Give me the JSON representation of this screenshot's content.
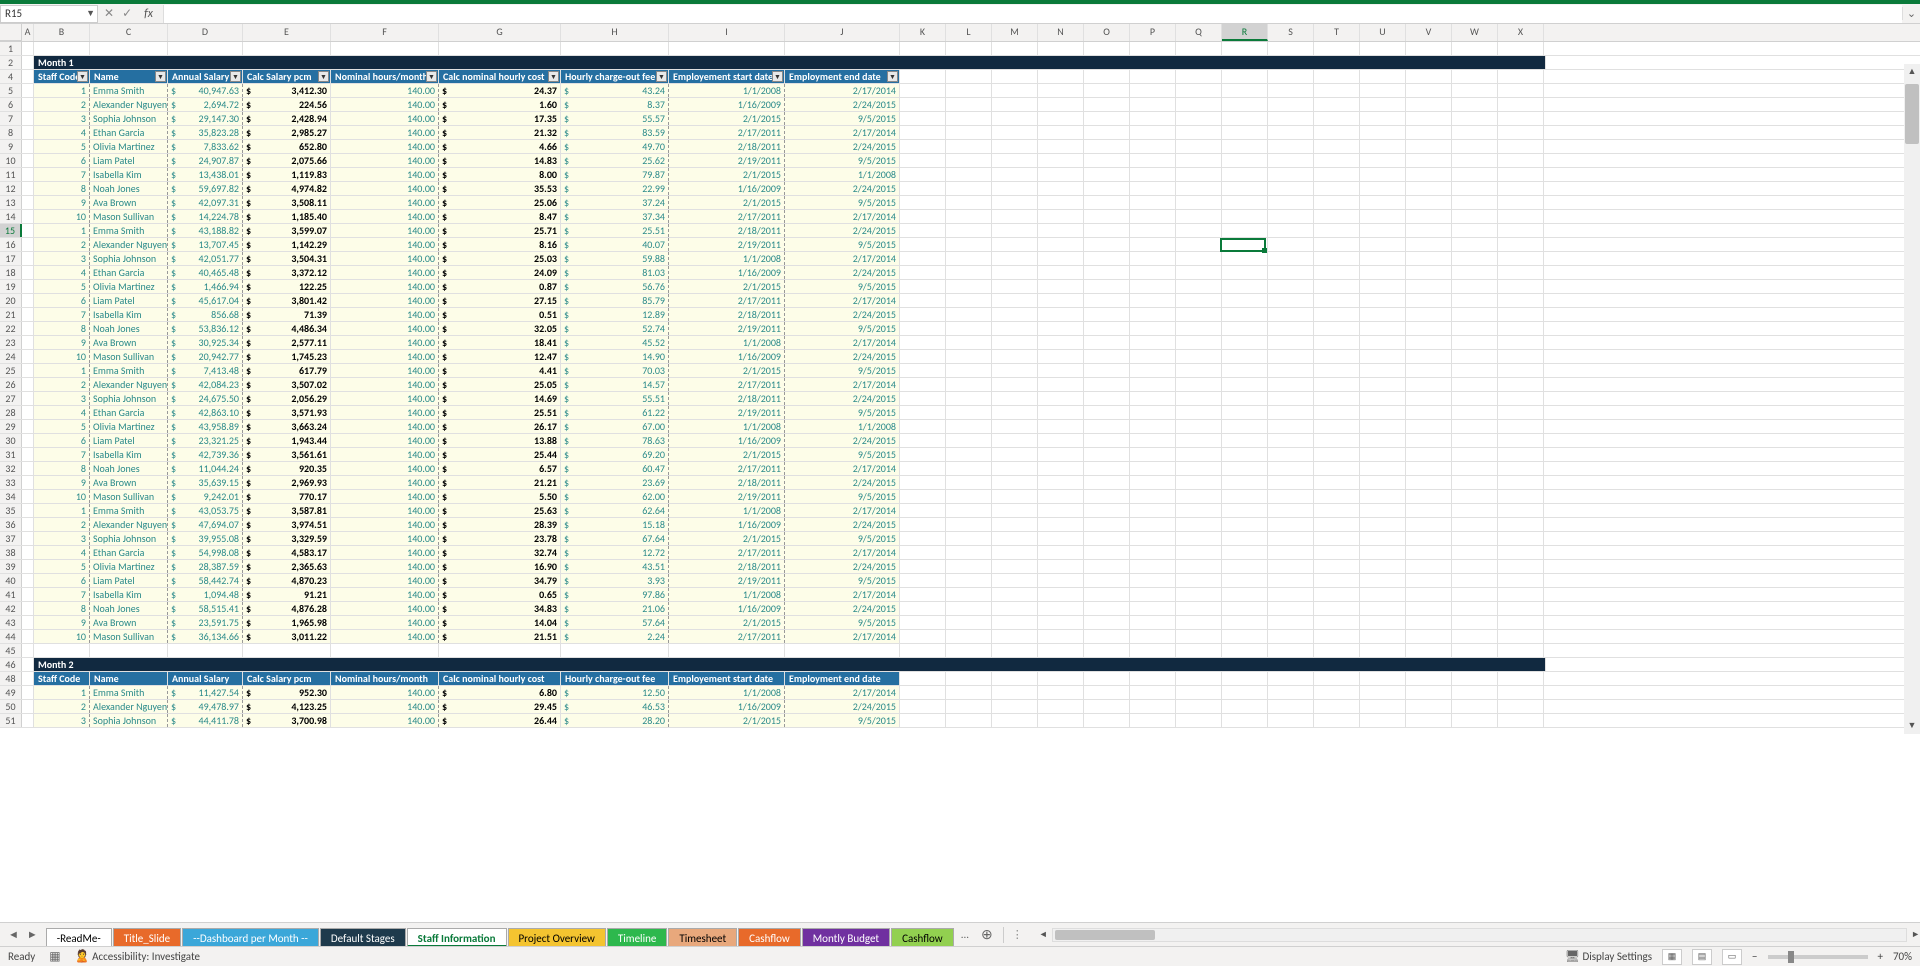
{
  "nameBox": "R15",
  "formulaValue": "",
  "fbIcons": {
    "cancel": "✕",
    "confirm": "✓",
    "fx": "fx"
  },
  "columns": [
    "A",
    "B",
    "C",
    "D",
    "E",
    "F",
    "G",
    "H",
    "I",
    "J",
    "K",
    "L",
    "M",
    "N",
    "O",
    "P",
    "Q",
    "R",
    "S",
    "T",
    "U",
    "V",
    "W",
    "X"
  ],
  "rowStart": 1,
  "month1": {
    "title": "Month 1"
  },
  "month2": {
    "title": "Month 2"
  },
  "tblHeaders": [
    "Staff Code",
    "Name",
    "Annual Salary",
    "Calc Salary pcm",
    "Nominal hours/month",
    "Calc nominal hourly cost",
    "Hourly charge-out fee",
    "Employement start date",
    "Employment end date"
  ],
  "data": [
    {
      "code": 1,
      "name": "Emma Smith",
      "salary": "40,947.63",
      "pcm": "3,412.30",
      "hours": "140.00",
      "hourly": "24.37",
      "fee": "43.24",
      "start": "1/1/2008",
      "end": "2/17/2014"
    },
    {
      "code": 2,
      "name": "Alexander Nguyen",
      "salary": "2,694.72",
      "pcm": "224.56",
      "hours": "140.00",
      "hourly": "1.60",
      "fee": "8.37",
      "start": "1/16/2009",
      "end": "2/24/2015"
    },
    {
      "code": 3,
      "name": "Sophia Johnson",
      "salary": "29,147.30",
      "pcm": "2,428.94",
      "hours": "140.00",
      "hourly": "17.35",
      "fee": "55.57",
      "start": "2/1/2015",
      "end": "9/5/2015"
    },
    {
      "code": 4,
      "name": "Ethan Garcia",
      "salary": "35,823.28",
      "pcm": "2,985.27",
      "hours": "140.00",
      "hourly": "21.32",
      "fee": "83.59",
      "start": "2/17/2011",
      "end": "2/17/2014"
    },
    {
      "code": 5,
      "name": "Olivia Martinez",
      "salary": "7,833.62",
      "pcm": "652.80",
      "hours": "140.00",
      "hourly": "4.66",
      "fee": "49.70",
      "start": "2/18/2011",
      "end": "2/24/2015"
    },
    {
      "code": 6,
      "name": "Liam Patel",
      "salary": "24,907.87",
      "pcm": "2,075.66",
      "hours": "140.00",
      "hourly": "14.83",
      "fee": "25.62",
      "start": "2/19/2011",
      "end": "9/5/2015"
    },
    {
      "code": 7,
      "name": "Isabella Kim",
      "salary": "13,438.01",
      "pcm": "1,119.83",
      "hours": "140.00",
      "hourly": "8.00",
      "fee": "79.87",
      "start": "2/1/2015",
      "end": "1/1/2008"
    },
    {
      "code": 8,
      "name": "Noah Jones",
      "salary": "59,697.82",
      "pcm": "4,974.82",
      "hours": "140.00",
      "hourly": "35.53",
      "fee": "22.99",
      "start": "1/16/2009",
      "end": "2/24/2015"
    },
    {
      "code": 9,
      "name": "Ava Brown",
      "salary": "42,097.31",
      "pcm": "3,508.11",
      "hours": "140.00",
      "hourly": "25.06",
      "fee": "37.24",
      "start": "2/1/2015",
      "end": "9/5/2015"
    },
    {
      "code": 10,
      "name": "Mason Sullivan",
      "salary": "14,224.78",
      "pcm": "1,185.40",
      "hours": "140.00",
      "hourly": "8.47",
      "fee": "37.34",
      "start": "2/17/2011",
      "end": "2/17/2014"
    },
    {
      "code": 1,
      "name": "Emma Smith",
      "salary": "43,188.82",
      "pcm": "3,599.07",
      "hours": "140.00",
      "hourly": "25.71",
      "fee": "25.51",
      "start": "2/18/2011",
      "end": "2/24/2015"
    },
    {
      "code": 2,
      "name": "Alexander Nguyen",
      "salary": "13,707.45",
      "pcm": "1,142.29",
      "hours": "140.00",
      "hourly": "8.16",
      "fee": "40.07",
      "start": "2/19/2011",
      "end": "9/5/2015"
    },
    {
      "code": 3,
      "name": "Sophia Johnson",
      "salary": "42,051.77",
      "pcm": "3,504.31",
      "hours": "140.00",
      "hourly": "25.03",
      "fee": "59.88",
      "start": "1/1/2008",
      "end": "2/17/2014"
    },
    {
      "code": 4,
      "name": "Ethan Garcia",
      "salary": "40,465.48",
      "pcm": "3,372.12",
      "hours": "140.00",
      "hourly": "24.09",
      "fee": "81.03",
      "start": "1/16/2009",
      "end": "2/24/2015"
    },
    {
      "code": 5,
      "name": "Olivia Martinez",
      "salary": "1,466.94",
      "pcm": "122.25",
      "hours": "140.00",
      "hourly": "0.87",
      "fee": "56.76",
      "start": "2/1/2015",
      "end": "9/5/2015"
    },
    {
      "code": 6,
      "name": "Liam Patel",
      "salary": "45,617.04",
      "pcm": "3,801.42",
      "hours": "140.00",
      "hourly": "27.15",
      "fee": "85.79",
      "start": "2/17/2011",
      "end": "2/17/2014"
    },
    {
      "code": 7,
      "name": "Isabella Kim",
      "salary": "856.68",
      "pcm": "71.39",
      "hours": "140.00",
      "hourly": "0.51",
      "fee": "12.89",
      "start": "2/18/2011",
      "end": "2/24/2015"
    },
    {
      "code": 8,
      "name": "Noah Jones",
      "salary": "53,836.12",
      "pcm": "4,486.34",
      "hours": "140.00",
      "hourly": "32.05",
      "fee": "52.74",
      "start": "2/19/2011",
      "end": "9/5/2015"
    },
    {
      "code": 9,
      "name": "Ava Brown",
      "salary": "30,925.34",
      "pcm": "2,577.11",
      "hours": "140.00",
      "hourly": "18.41",
      "fee": "45.52",
      "start": "1/1/2008",
      "end": "2/17/2014"
    },
    {
      "code": 10,
      "name": "Mason Sullivan",
      "salary": "20,942.77",
      "pcm": "1,745.23",
      "hours": "140.00",
      "hourly": "12.47",
      "fee": "14.90",
      "start": "1/16/2009",
      "end": "2/24/2015"
    },
    {
      "code": 1,
      "name": "Emma Smith",
      "salary": "7,413.48",
      "pcm": "617.79",
      "hours": "140.00",
      "hourly": "4.41",
      "fee": "70.03",
      "start": "2/1/2015",
      "end": "9/5/2015"
    },
    {
      "code": 2,
      "name": "Alexander Nguyen",
      "salary": "42,084.23",
      "pcm": "3,507.02",
      "hours": "140.00",
      "hourly": "25.05",
      "fee": "14.57",
      "start": "2/17/2011",
      "end": "2/17/2014"
    },
    {
      "code": 3,
      "name": "Sophia Johnson",
      "salary": "24,675.50",
      "pcm": "2,056.29",
      "hours": "140.00",
      "hourly": "14.69",
      "fee": "55.51",
      "start": "2/18/2011",
      "end": "2/24/2015"
    },
    {
      "code": 4,
      "name": "Ethan Garcia",
      "salary": "42,863.10",
      "pcm": "3,571.93",
      "hours": "140.00",
      "hourly": "25.51",
      "fee": "61.22",
      "start": "2/19/2011",
      "end": "9/5/2015"
    },
    {
      "code": 5,
      "name": "Olivia Martinez",
      "salary": "43,958.89",
      "pcm": "3,663.24",
      "hours": "140.00",
      "hourly": "26.17",
      "fee": "67.00",
      "start": "1/1/2008",
      "end": "1/1/2008"
    },
    {
      "code": 6,
      "name": "Liam Patel",
      "salary": "23,321.25",
      "pcm": "1,943.44",
      "hours": "140.00",
      "hourly": "13.88",
      "fee": "78.63",
      "start": "1/16/2009",
      "end": "2/24/2015"
    },
    {
      "code": 7,
      "name": "Isabella Kim",
      "salary": "42,739.36",
      "pcm": "3,561.61",
      "hours": "140.00",
      "hourly": "25.44",
      "fee": "69.20",
      "start": "2/1/2015",
      "end": "9/5/2015"
    },
    {
      "code": 8,
      "name": "Noah Jones",
      "salary": "11,044.24",
      "pcm": "920.35",
      "hours": "140.00",
      "hourly": "6.57",
      "fee": "60.47",
      "start": "2/17/2011",
      "end": "2/17/2014"
    },
    {
      "code": 9,
      "name": "Ava Brown",
      "salary": "35,639.15",
      "pcm": "2,969.93",
      "hours": "140.00",
      "hourly": "21.21",
      "fee": "23.69",
      "start": "2/18/2011",
      "end": "2/24/2015"
    },
    {
      "code": 10,
      "name": "Mason Sullivan",
      "salary": "9,242.01",
      "pcm": "770.17",
      "hours": "140.00",
      "hourly": "5.50",
      "fee": "62.00",
      "start": "2/19/2011",
      "end": "9/5/2015"
    },
    {
      "code": 1,
      "name": "Emma Smith",
      "salary": "43,053.75",
      "pcm": "3,587.81",
      "hours": "140.00",
      "hourly": "25.63",
      "fee": "62.64",
      "start": "1/1/2008",
      "end": "2/17/2014"
    },
    {
      "code": 2,
      "name": "Alexander Nguyen",
      "salary": "47,694.07",
      "pcm": "3,974.51",
      "hours": "140.00",
      "hourly": "28.39",
      "fee": "15.18",
      "start": "1/16/2009",
      "end": "2/24/2015"
    },
    {
      "code": 3,
      "name": "Sophia Johnson",
      "salary": "39,955.08",
      "pcm": "3,329.59",
      "hours": "140.00",
      "hourly": "23.78",
      "fee": "67.64",
      "start": "2/1/2015",
      "end": "9/5/2015"
    },
    {
      "code": 4,
      "name": "Ethan Garcia",
      "salary": "54,998.08",
      "pcm": "4,583.17",
      "hours": "140.00",
      "hourly": "32.74",
      "fee": "12.72",
      "start": "2/17/2011",
      "end": "2/17/2014"
    },
    {
      "code": 5,
      "name": "Olivia Martinez",
      "salary": "28,387.59",
      "pcm": "2,365.63",
      "hours": "140.00",
      "hourly": "16.90",
      "fee": "43.51",
      "start": "2/18/2011",
      "end": "2/24/2015"
    },
    {
      "code": 6,
      "name": "Liam Patel",
      "salary": "58,442.74",
      "pcm": "4,870.23",
      "hours": "140.00",
      "hourly": "34.79",
      "fee": "3.93",
      "start": "2/19/2011",
      "end": "9/5/2015"
    },
    {
      "code": 7,
      "name": "Isabella Kim",
      "salary": "1,094.48",
      "pcm": "91.21",
      "hours": "140.00",
      "hourly": "0.65",
      "fee": "97.86",
      "start": "1/1/2008",
      "end": "2/17/2014"
    },
    {
      "code": 8,
      "name": "Noah Jones",
      "salary": "58,515.41",
      "pcm": "4,876.28",
      "hours": "140.00",
      "hourly": "34.83",
      "fee": "21.06",
      "start": "1/16/2009",
      "end": "2/24/2015"
    },
    {
      "code": 9,
      "name": "Ava Brown",
      "salary": "23,591.75",
      "pcm": "1,965.98",
      "hours": "140.00",
      "hourly": "14.04",
      "fee": "57.64",
      "start": "2/1/2015",
      "end": "9/5/2015"
    },
    {
      "code": 10,
      "name": "Mason Sullivan",
      "salary": "36,134.66",
      "pcm": "3,011.22",
      "hours": "140.00",
      "hourly": "21.51",
      "fee": "2.24",
      "start": "2/17/2011",
      "end": "2/17/2014"
    }
  ],
  "data2": [
    {
      "code": 1,
      "name": "Emma Smith",
      "salary": "11,427.54",
      "pcm": "952.30",
      "hours": "140.00",
      "hourly": "6.80",
      "fee": "12.50",
      "start": "1/1/2008",
      "end": "2/17/2014"
    },
    {
      "code": 2,
      "name": "Alexander Nguyen",
      "salary": "49,478.97",
      "pcm": "4,123.25",
      "hours": "140.00",
      "hourly": "29.45",
      "fee": "46.53",
      "start": "1/16/2009",
      "end": "2/24/2015"
    },
    {
      "code": 3,
      "name": "Sophia Johnson",
      "salary": "44,411.78",
      "pcm": "3,700.98",
      "hours": "140.00",
      "hourly": "26.44",
      "fee": "28.20",
      "start": "2/1/2015",
      "end": "9/5/2015"
    }
  ],
  "sheetTabs": [
    {
      "label": "-ReadMe-",
      "bg": "#ffffff",
      "fg": "#000",
      "active": false
    },
    {
      "label": "Title_Slide",
      "bg": "#e86a2a",
      "fg": "#fff",
      "active": false
    },
    {
      "label": "--Dashboard per Month --",
      "bg": "#3ba7d9",
      "fg": "#fff",
      "active": false
    },
    {
      "label": "Default Stages",
      "bg": "#1e3a4c",
      "fg": "#fff",
      "active": false
    },
    {
      "label": "Staff Information",
      "bg": "#ffffff",
      "fg": "#0a7a3a",
      "active": true
    },
    {
      "label": "Project Overview",
      "bg": "#f4c430",
      "fg": "#000",
      "active": false
    },
    {
      "label": "Timeline",
      "bg": "#2db84d",
      "fg": "#fff",
      "active": false
    },
    {
      "label": "Timesheet",
      "bg": "#e8a87c",
      "fg": "#000",
      "active": false
    },
    {
      "label": "Cashflow",
      "bg": "#e86a2a",
      "fg": "#fff",
      "active": false
    },
    {
      "label": "Montly Budget",
      "bg": "#7030a0",
      "fg": "#fff",
      "active": false
    },
    {
      "label": "Cashflow",
      "bg": "#92d050",
      "fg": "#000",
      "active": false
    }
  ],
  "tabMore": "...",
  "statusBar": {
    "ready": "Ready",
    "accessibility": "Accessibility: Investigate",
    "displaySettings": "Display Settings",
    "zoom": "70%"
  }
}
